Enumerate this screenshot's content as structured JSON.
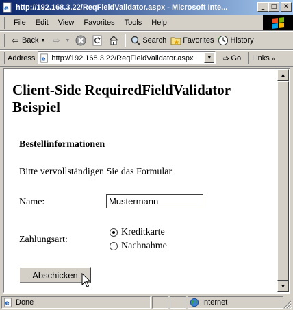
{
  "window": {
    "title": "http://192.168.3.22/ReqFieldValidator.aspx - Microsoft Inte...",
    "min_glyph": "_",
    "max_glyph": "□",
    "close_glyph": "✕"
  },
  "menu": [
    "File",
    "Edit",
    "View",
    "Favorites",
    "Tools",
    "Help"
  ],
  "toolbar": {
    "back_label": "Back",
    "search_label": "Search",
    "favorites_label": "Favorites",
    "history_label": "History"
  },
  "address": {
    "label": "Address",
    "url": "http://192.168.3.22/ReqFieldValidator.aspx",
    "go_label": "Go",
    "links_label": "Links"
  },
  "page": {
    "heading": "Client-Side RequiredFieldValidator Beispiel",
    "section_title": "Bestellinformationen",
    "intro": "Bitte vervollständigen Sie das Formular",
    "name_label": "Name:",
    "name_value": "Mustermann",
    "payment_label": "Zahlungsart:",
    "payment_options": [
      {
        "label": "Kreditkarte",
        "selected": true
      },
      {
        "label": "Nachnahme",
        "selected": false
      }
    ],
    "submit_label": "Abschicken"
  },
  "status": {
    "text": "Done",
    "zone": "Internet"
  }
}
